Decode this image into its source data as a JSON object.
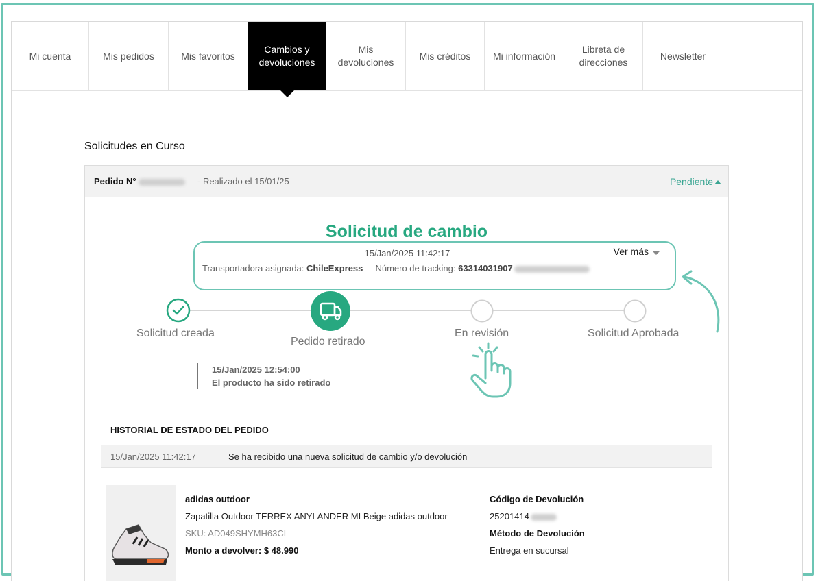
{
  "tabs": [
    {
      "label": "Mi cuenta"
    },
    {
      "label": "Mis pedidos"
    },
    {
      "label": "Mis favoritos"
    },
    {
      "label": "Cambios y devoluciones"
    },
    {
      "label": "Mis devoluciones"
    },
    {
      "label": "Mis créditos"
    },
    {
      "label": "Mi información"
    },
    {
      "label": "Libreta de direcciones"
    },
    {
      "label": "Newsletter"
    }
  ],
  "section_title": "Solicitudes en Curso",
  "order": {
    "label": "Pedido N°",
    "date_text": "- Realizado el 15/01/25",
    "status": "Pendiente"
  },
  "request": {
    "title": "Solicitud de cambio",
    "date": "15/Jan/2025 11:42:17",
    "carrier_label": "Transportadora asignada:",
    "carrier": "ChileExpress",
    "tracking_label": "Número de tracking:",
    "tracking": "63314031907",
    "more_label": "Ver más"
  },
  "steps": [
    {
      "label": "Solicitud creada",
      "state": "done"
    },
    {
      "label": "Pedido retirado",
      "state": "current"
    },
    {
      "label": "En revisión",
      "state": "pending"
    },
    {
      "label": "Solicitud Aprobada",
      "state": "pending"
    }
  ],
  "step_detail": {
    "date": "15/Jan/2025 12:54:00",
    "text": "El producto ha sido retirado"
  },
  "history": {
    "title": "HISTORIAL DE ESTADO DEL PEDIDO",
    "rows": [
      {
        "date": "15/Jan/2025 11:42:17",
        "text": "Se ha recibido una nueva solicitud de cambio y/o devolución"
      }
    ]
  },
  "product": {
    "brand": "adidas outdoor",
    "name": "Zapatilla Outdoor TERREX ANYLANDER MI Beige adidas outdoor",
    "sku": "SKU: AD049SHYMH63CL",
    "refund": "Monto a devolver: $ 48.990",
    "return_code_label": "Código de Devolución",
    "return_code": "25201414",
    "return_method_label": "Método de Devolución",
    "return_method": "Entrega en sucursal"
  },
  "colors": {
    "accent": "#27a880",
    "outline": "#6cc5b4"
  }
}
